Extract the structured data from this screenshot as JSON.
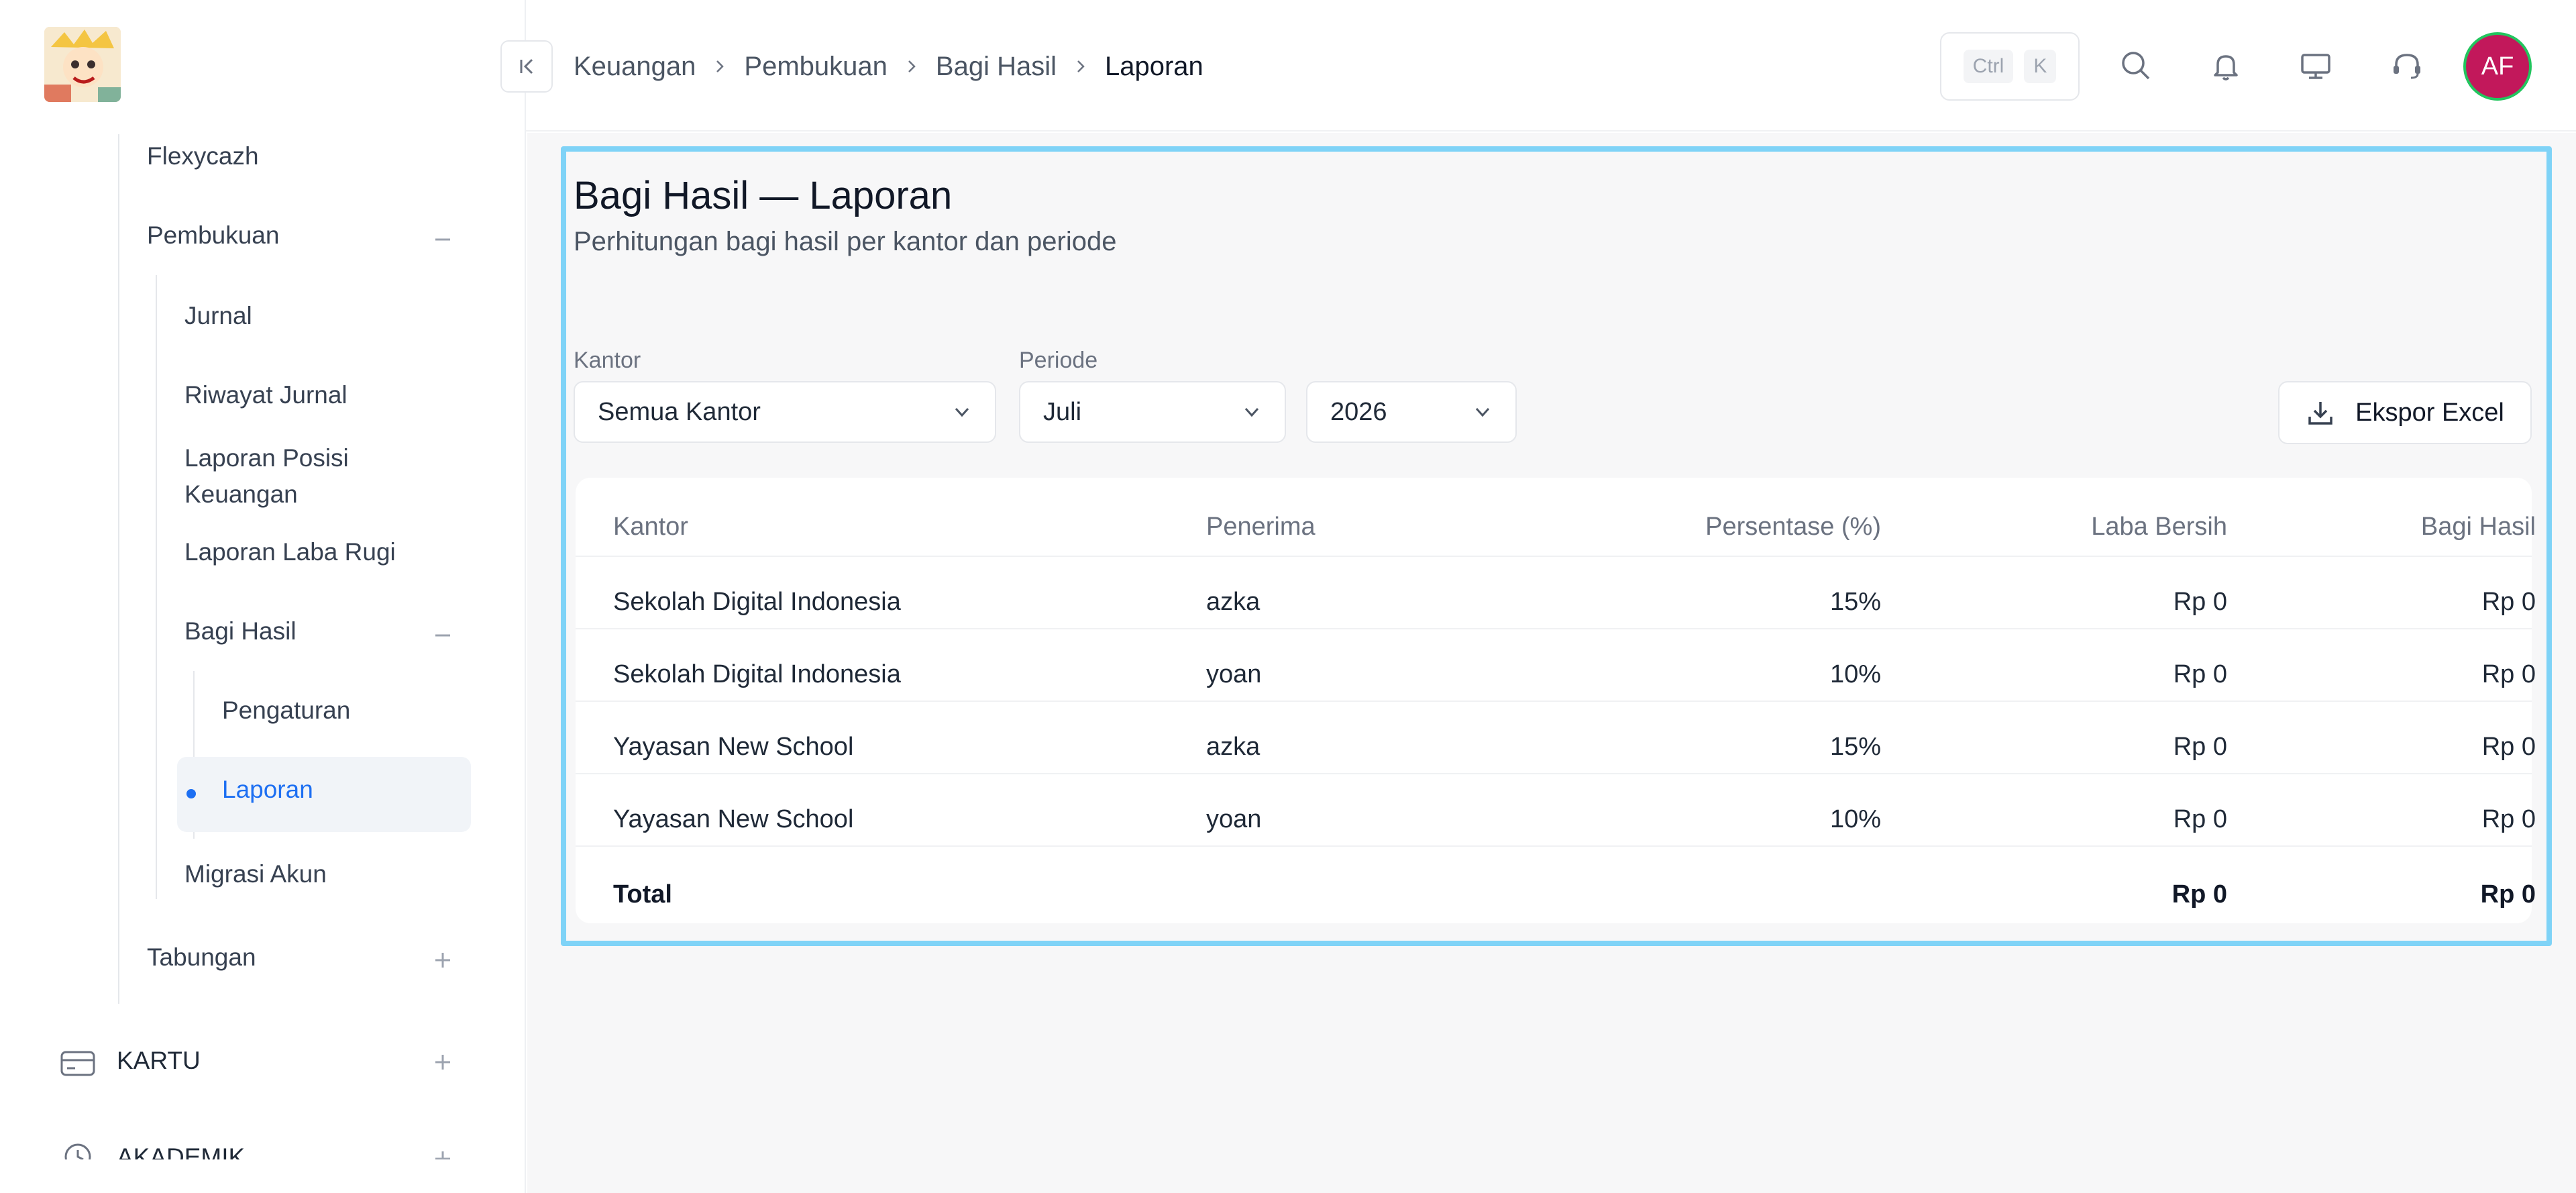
{
  "sidebar": {
    "items": [
      {
        "label": "Flexycazh"
      },
      {
        "label": "Pembukuan"
      },
      {
        "label": "Jurnal"
      },
      {
        "label": "Riwayat Jurnal"
      },
      {
        "label": "Laporan Posisi Keuangan"
      },
      {
        "label": "Laporan Laba Rugi"
      },
      {
        "label": "Bagi Hasil"
      },
      {
        "label": "Pengaturan"
      },
      {
        "label": "Laporan"
      },
      {
        "label": "Migrasi Akun"
      },
      {
        "label": "Tabungan"
      },
      {
        "label": "KARTU"
      },
      {
        "label": "AKADEMIK"
      }
    ]
  },
  "breadcrumb": {
    "items": [
      "Keuangan",
      "Pembukuan",
      "Bagi Hasil",
      "Laporan"
    ]
  },
  "header": {
    "kbd_ctrl": "Ctrl",
    "kbd_k": "K",
    "avatar_initials": "AF"
  },
  "page": {
    "title": "Bagi Hasil — Laporan",
    "subtitle": "Perhitungan bagi hasil per kantor dan periode"
  },
  "filters": {
    "kantor_label": "Kantor",
    "kantor_value": "Semua Kantor",
    "periode_label": "Periode",
    "bulan_value": "Juli",
    "tahun_value": "2026",
    "export_label": "Ekspor Excel"
  },
  "table": {
    "headers": [
      "Kantor",
      "Penerima",
      "Persentase (%)",
      "Laba Bersih",
      "Bagi Hasil"
    ],
    "rows": [
      [
        "Sekolah Digital Indonesia",
        "azka",
        "15%",
        "Rp 0",
        "Rp 0"
      ],
      [
        "Sekolah Digital Indonesia",
        "yoan",
        "10%",
        "Rp 0",
        "Rp 0"
      ],
      [
        "Yayasan New School",
        "azka",
        "15%",
        "Rp 0",
        "Rp 0"
      ],
      [
        "Yayasan New School",
        "yoan",
        "10%",
        "Rp 0",
        "Rp 0"
      ]
    ],
    "total": {
      "label": "Total",
      "laba": "Rp 0",
      "bagi": "Rp 0"
    }
  },
  "colors": {
    "accent": "#1d6ff2",
    "avatar_bg": "#c2185b",
    "avatar_ring": "#22c55e",
    "highlight_frame": "#7fd3f7"
  }
}
